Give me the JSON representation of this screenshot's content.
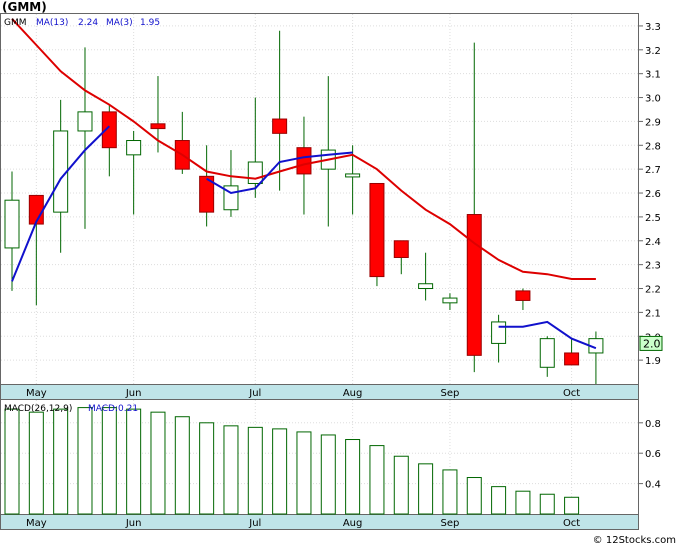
{
  "header": {
    "ticker": "(GMM)"
  },
  "footer": {
    "credit": "© 12Stocks.com"
  },
  "colors": {
    "up_fill": "#ffffff",
    "candle_stroke": "#006600",
    "down_fill": "#ff0000",
    "ma13": "#dd0000",
    "ma3": "#1111cc",
    "macd_bar_fill": "#ffffff",
    "macd_bar_stroke": "#006600",
    "axis_band": "#bfe4e8",
    "price_box_fill": "#ccffcc"
  },
  "chart_data": [
    {
      "type": "candlestick",
      "legend": {
        "symbol": "GMM",
        "ma13_label": "MA(13)",
        "ma13_value": "2.24",
        "ma3_label": "MA(3)",
        "ma3_value": "1.95"
      },
      "ylim": [
        1.8,
        3.35
      ],
      "y_ticks": [
        "1.9",
        "2.0",
        "2.1",
        "2.2",
        "2.3",
        "2.4",
        "2.5",
        "2.6",
        "2.7",
        "2.8",
        "2.9",
        "3.0",
        "3.1",
        "3.2",
        "3.3"
      ],
      "month_labels": [
        {
          "label": "May",
          "week": 1
        },
        {
          "label": "Jun",
          "week": 5
        },
        {
          "label": "Jul",
          "week": 10
        },
        {
          "label": "Aug",
          "week": 14
        },
        {
          "label": "Sep",
          "week": 18
        },
        {
          "label": "Oct",
          "week": 23
        }
      ],
      "last_price_label": "2.0",
      "last_price": 1.97,
      "candles": [
        {
          "o": 2.37,
          "h": 2.69,
          "l": 2.19,
          "c": 2.57
        },
        {
          "o": 2.59,
          "h": 2.59,
          "l": 2.13,
          "c": 2.47
        },
        {
          "o": 2.52,
          "h": 2.99,
          "l": 2.35,
          "c": 2.86
        },
        {
          "o": 2.86,
          "h": 3.21,
          "l": 2.45,
          "c": 2.94
        },
        {
          "o": 2.94,
          "h": 2.97,
          "l": 2.67,
          "c": 2.79
        },
        {
          "o": 2.76,
          "h": 2.86,
          "l": 2.51,
          "c": 2.82
        },
        {
          "o": 2.89,
          "h": 3.09,
          "l": 2.77,
          "c": 2.87
        },
        {
          "o": 2.82,
          "h": 2.94,
          "l": 2.68,
          "c": 2.7
        },
        {
          "o": 2.67,
          "h": 2.8,
          "l": 2.46,
          "c": 2.52
        },
        {
          "o": 2.53,
          "h": 2.78,
          "l": 2.5,
          "c": 2.63
        },
        {
          "o": 2.64,
          "h": 3.0,
          "l": 2.58,
          "c": 2.73
        },
        {
          "o": 2.91,
          "h": 3.28,
          "l": 2.61,
          "c": 2.85
        },
        {
          "o": 2.79,
          "h": 2.92,
          "l": 2.51,
          "c": 2.68
        },
        {
          "o": 2.7,
          "h": 3.09,
          "l": 2.46,
          "c": 2.78
        },
        {
          "o": 2.68,
          "h": 2.8,
          "l": 2.51,
          "c": 2.68
        },
        {
          "o": 2.64,
          "h": 2.64,
          "l": 2.21,
          "c": 2.25
        },
        {
          "o": 2.4,
          "h": 2.4,
          "l": 2.26,
          "c": 2.33
        },
        {
          "o": 2.2,
          "h": 2.35,
          "l": 2.15,
          "c": 2.22
        },
        {
          "o": 2.14,
          "h": 2.18,
          "l": 2.11,
          "c": 2.16
        },
        {
          "o": 2.51,
          "h": 3.23,
          "l": 1.85,
          "c": 1.92
        },
        {
          "o": 1.97,
          "h": 2.09,
          "l": 1.89,
          "c": 2.06
        },
        {
          "o": 2.19,
          "h": 2.2,
          "l": 2.11,
          "c": 2.15
        },
        {
          "o": 1.87,
          "h": 2.0,
          "l": 1.83,
          "c": 1.99
        },
        {
          "o": 1.93,
          "h": 1.99,
          "l": 1.88,
          "c": 1.88
        },
        {
          "o": 1.93,
          "h": 2.02,
          "l": 1.8,
          "c": 1.99
        }
      ],
      "series": [
        {
          "name": "MA(13)",
          "values": [
            3.33,
            3.22,
            3.11,
            3.03,
            2.97,
            2.9,
            2.82,
            2.76,
            2.69,
            2.67,
            2.66,
            2.69,
            2.72,
            2.74,
            2.76,
            2.7,
            2.61,
            2.53,
            2.47,
            2.39,
            2.32,
            2.27,
            2.26,
            2.24,
            2.24
          ]
        },
        {
          "name": "MA(3)",
          "values": [
            2.23,
            2.48,
            2.66,
            2.78,
            2.88,
            null,
            null,
            null,
            2.66,
            2.6,
            2.62,
            2.73,
            2.75,
            2.76,
            2.77,
            null,
            null,
            null,
            null,
            null,
            2.04,
            2.04,
            2.06,
            1.99,
            1.95
          ]
        }
      ]
    },
    {
      "type": "bar",
      "legend": {
        "label": "MACD(26,12,9)",
        "value_label": "MACD:0.21"
      },
      "ylim": [
        0.2,
        0.95
      ],
      "y_ticks": [
        "0.4",
        "0.6",
        "0.8"
      ],
      "month_labels": [
        {
          "label": "May",
          "week": 1
        },
        {
          "label": "Jun",
          "week": 5
        },
        {
          "label": "Jul",
          "week": 10
        },
        {
          "label": "Aug",
          "week": 14
        },
        {
          "label": "Sep",
          "week": 18
        },
        {
          "label": "Oct",
          "week": 23
        }
      ],
      "values": [
        0.89,
        0.87,
        0.89,
        0.9,
        0.9,
        0.89,
        0.87,
        0.84,
        0.8,
        0.78,
        0.77,
        0.76,
        0.74,
        0.72,
        0.69,
        0.65,
        0.58,
        0.53,
        0.49,
        0.44,
        0.38,
        0.35,
        0.33,
        0.31,
        null
      ]
    }
  ]
}
